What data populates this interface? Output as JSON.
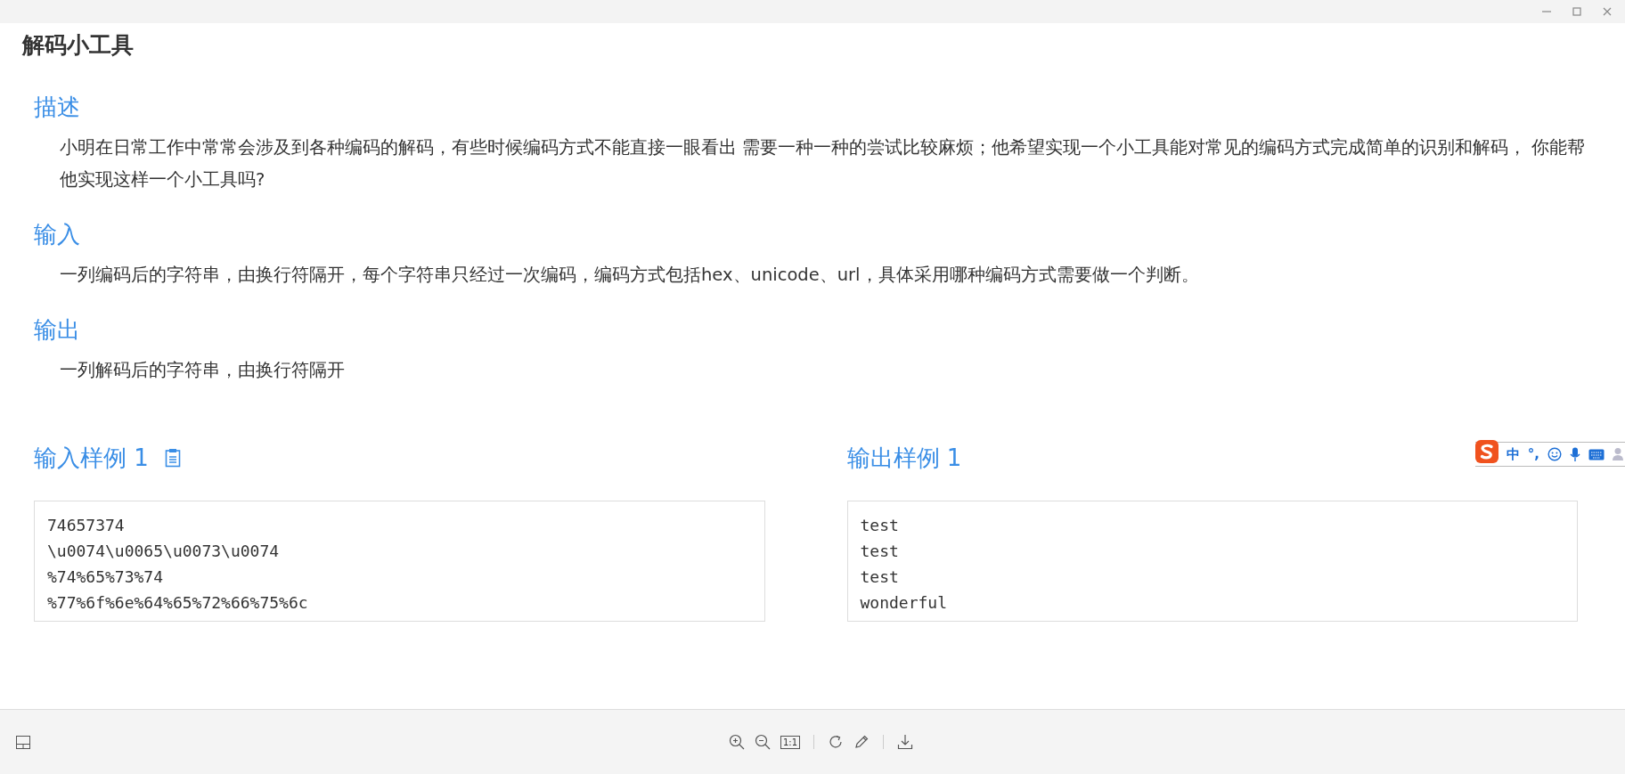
{
  "window": {
    "title": "解码小工具"
  },
  "sections": [
    {
      "heading": "描述",
      "text": "小明在日常工作中常常会涉及到各种编码的解码，有些时候编码方式不能直接一眼看出 需要一种一种的尝试比较麻烦；他希望实现一个小工具能对常见的编码方式完成简单的识别和解码， 你能帮他实现这样一个小工具吗?"
    },
    {
      "heading": "输入",
      "text": "一列编码后的字符串，由换行符隔开，每个字符串只经过一次编码，编码方式包括hex、unicode、url，具体采用哪种编码方式需要做一个判断。"
    },
    {
      "heading": "输出",
      "text": "一列解码后的字符串，由换行符隔开"
    }
  ],
  "samples": [
    {
      "heading": "输入样例 1",
      "copy_icon": true,
      "lines": [
        "74657374",
        "\\u0074\\u0065\\u0073\\u0074",
        "%74%65%73%74",
        "%77%6f%6e%64%65%72%66%75%6c"
      ]
    },
    {
      "heading": "输出样例 1",
      "copy_icon": false,
      "lines": [
        "test",
        "test",
        "test",
        "wonderful"
      ]
    }
  ],
  "ime_toolbar": {
    "mode": "中",
    "punctuation": "°,"
  },
  "viewer_toolbar": {
    "actual_size": "1:1"
  }
}
